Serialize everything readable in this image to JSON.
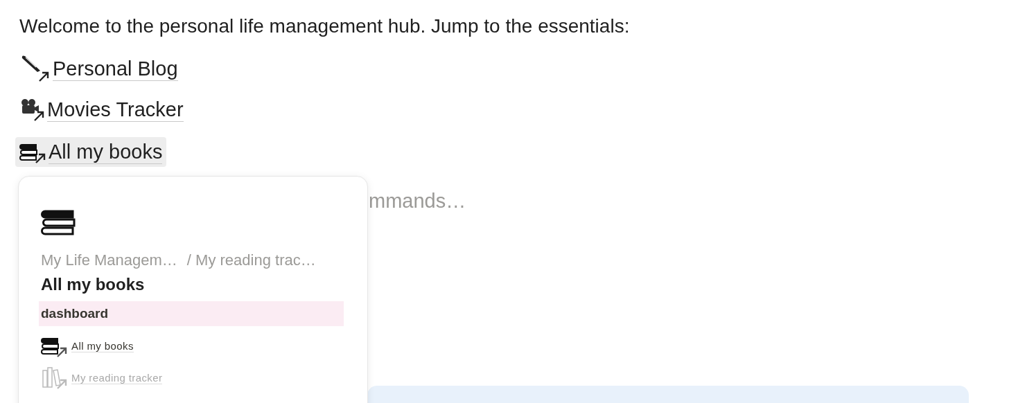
{
  "intro": "Welcome to the personal life management hub. Jump to the essentials:",
  "links": [
    {
      "kind": "quill",
      "label": "Personal Blog",
      "hovered": false
    },
    {
      "kind": "camera",
      "label": "Movies Tracker",
      "hovered": false
    },
    {
      "kind": "books",
      "label": "All my books",
      "hovered": true
    }
  ],
  "placeholder": "mmands…",
  "preview": {
    "breadcrumbs": [
      "My Life Managem…",
      "/ My reading trac…"
    ],
    "title": "All my books",
    "section": "dashboard",
    "items": [
      {
        "kind": "books",
        "label": "All my books",
        "muted": false
      },
      {
        "kind": "shelf",
        "label": "My reading tracker",
        "muted": true
      }
    ]
  }
}
